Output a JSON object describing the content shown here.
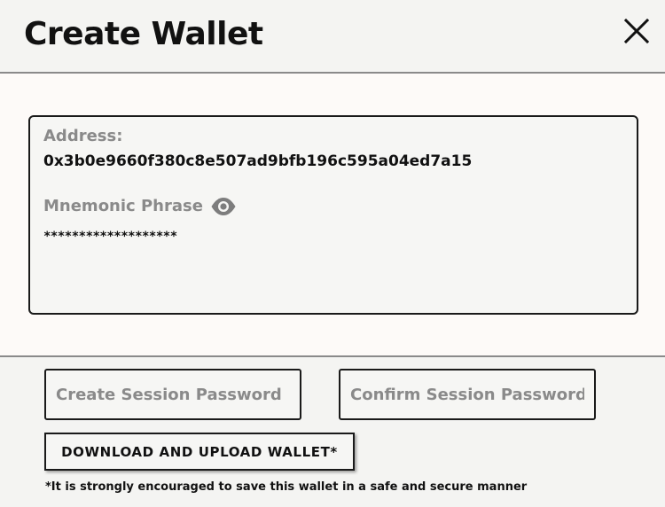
{
  "header": {
    "title": "Create Wallet",
    "close_icon": "close-icon"
  },
  "wallet": {
    "address_label": "Address:",
    "address_value": "0x3b0e9660f380c8e507ad9bfb196c595a04ed7a15",
    "mnemonic_label": "Mnemonic Phrase",
    "mnemonic_toggle_icon": "eye-icon",
    "mnemonic_value": "*******************"
  },
  "form": {
    "create_password_placeholder": "Create Session Password",
    "create_password_value": "",
    "confirm_password_placeholder": "Confirm Session Password",
    "confirm_password_value": "",
    "download_button_label": "DOWNLOAD AND UPLOAD WALLET*",
    "note": "*It is strongly encouraged to save this wallet in a safe and secure manner"
  },
  "colors": {
    "background": "#f4f4f2",
    "body_background": "#fdfaf8",
    "border": "#1a1a1a",
    "muted_text": "#8a8a8a"
  }
}
